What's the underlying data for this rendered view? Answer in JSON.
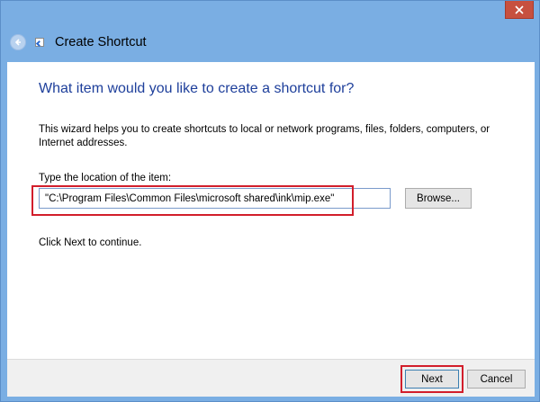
{
  "window": {
    "title": "Create Shortcut",
    "close_icon": "close-icon",
    "back_icon": "back-arrow-icon",
    "app_icon": "shortcut-icon",
    "accent_color": "#1e3f9b",
    "highlight_color": "#d21e2b"
  },
  "main": {
    "heading": "What item would you like to create a shortcut for?",
    "description": "This wizard helps you to create shortcuts to local or network programs, files, folders, computers, or Internet addresses.",
    "location_label": "Type the location of the item:",
    "location_value": "\"C:\\Program Files\\Common Files\\microsoft shared\\ink\\mip.exe\"",
    "browse_label": "Browse...",
    "next_hint": "Click Next to continue."
  },
  "footer": {
    "next_label": "Next",
    "cancel_label": "Cancel"
  }
}
